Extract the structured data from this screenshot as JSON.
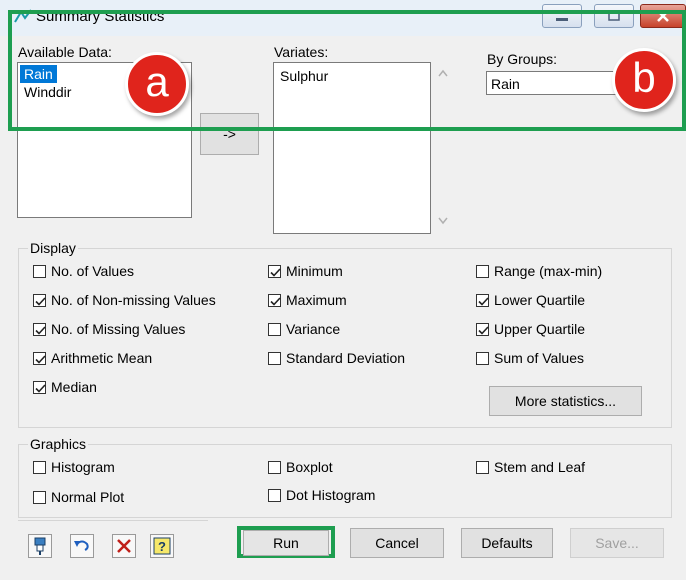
{
  "window": {
    "title": "Summary Statistics"
  },
  "available": {
    "label": "Available Data:",
    "items": [
      "Rain",
      "Winddir"
    ],
    "selected": 0
  },
  "move_button": {
    "label": "->"
  },
  "variates": {
    "label": "Variates:",
    "items": [
      "Sulphur"
    ]
  },
  "by_groups": {
    "label": "By Groups:",
    "value": "Rain"
  },
  "annotations": {
    "a": "a",
    "b": "b"
  },
  "display": {
    "title": "Display",
    "options": [
      {
        "label": "No. of Values",
        "checked": false
      },
      {
        "label": "No. of Non-missing Values",
        "checked": true
      },
      {
        "label": "No. of Missing Values",
        "checked": true
      },
      {
        "label": "Arithmetic Mean",
        "checked": true
      },
      {
        "label": "Median",
        "checked": true
      },
      {
        "label": "Minimum",
        "checked": true
      },
      {
        "label": "Maximum",
        "checked": true
      },
      {
        "label": "Variance",
        "checked": false
      },
      {
        "label": "Standard Deviation",
        "checked": false
      },
      {
        "label": "Range (max-min)",
        "checked": false
      },
      {
        "label": "Lower Quartile",
        "checked": true
      },
      {
        "label": "Upper Quartile",
        "checked": true
      },
      {
        "label": "Sum of Values",
        "checked": false
      }
    ],
    "more_label": "More statistics..."
  },
  "graphics": {
    "title": "Graphics",
    "options": [
      {
        "label": "Histogram",
        "checked": false
      },
      {
        "label": "Normal Plot",
        "checked": false
      },
      {
        "label": "Boxplot",
        "checked": false
      },
      {
        "label": "Dot Histogram",
        "checked": false
      },
      {
        "label": "Stem and Leaf",
        "checked": false
      }
    ]
  },
  "buttons": {
    "run": "Run",
    "cancel": "Cancel",
    "defaults": "Defaults",
    "save": "Save..."
  },
  "tools": [
    "pin-icon",
    "undo-icon",
    "clear-icon",
    "help-icon"
  ],
  "colors": {
    "highlight_green": "#1e9e50",
    "badge_red": "#e0241c",
    "selection_blue": "#0078d7"
  }
}
